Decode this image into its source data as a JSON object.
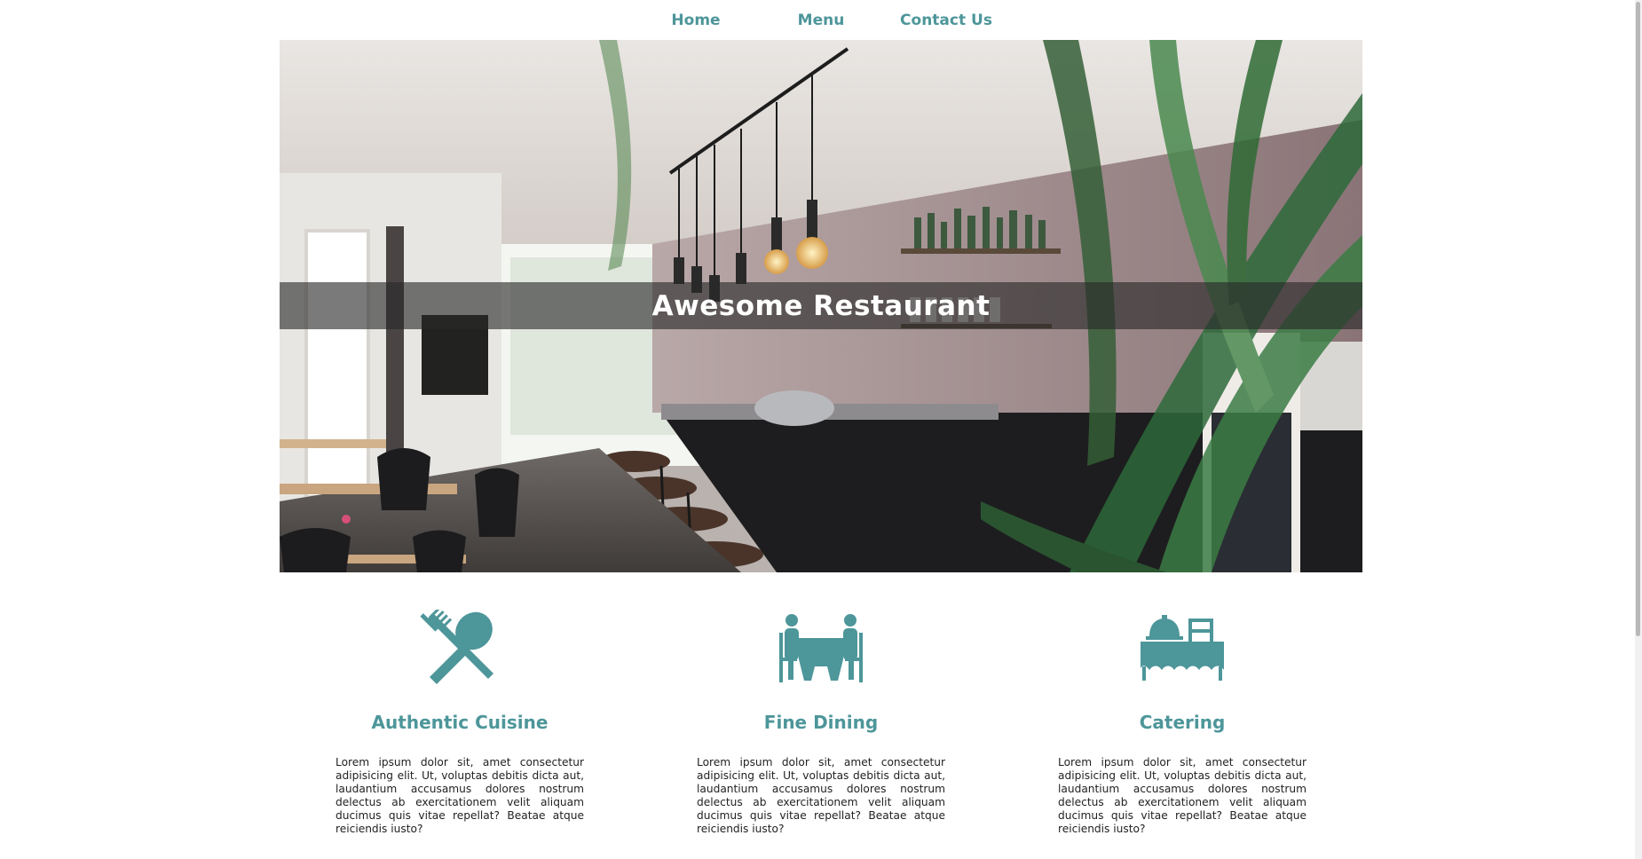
{
  "nav": {
    "items": [
      {
        "label": "Home"
      },
      {
        "label": "Menu"
      },
      {
        "label": "Contact Us"
      }
    ]
  },
  "hero": {
    "title": "Awesome Restaurant"
  },
  "features": [
    {
      "icon": "fork-spoon-icon",
      "title": "Authentic Cuisine",
      "text": "Lorem ipsum dolor sit, amet consectetur adipisicing elit. Ut, voluptas debitis dicta aut, laudantium accusamus dolores nostrum delectus ab exercitationem velit aliquam ducimus quis vitae repellat? Beatae atque reiciendis iusto?"
    },
    {
      "icon": "dining-table-icon",
      "title": "Fine Dining",
      "text": "Lorem ipsum dolor sit, amet consectetur adipisicing elit. Ut, voluptas debitis dicta aut, laudantium accusamus dolores nostrum delectus ab exercitationem velit aliquam ducimus quis vitae repellat? Beatae atque reiciendis iusto?"
    },
    {
      "icon": "catering-table-icon",
      "title": "Catering",
      "text": "Lorem ipsum dolor sit, amet consectetur adipisicing elit. Ut, voluptas debitis dicta aut, laudantium accusamus dolores nostrum delectus ab exercitationem velit aliquam ducimus quis vitae repellat? Beatae atque reiciendis iusto?"
    }
  ],
  "colors": {
    "accent": "#4d969a",
    "band": "#282828",
    "text": "#222222"
  }
}
